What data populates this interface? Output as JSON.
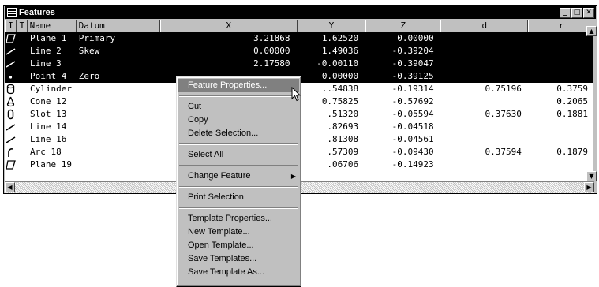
{
  "window": {
    "title": "Features",
    "buttons": [
      "_",
      "□",
      "✕"
    ]
  },
  "columns": [
    "I",
    "T",
    "Name",
    "Datum",
    "X",
    "Y",
    "Z",
    "d",
    "r"
  ],
  "rows": [
    {
      "icon": "plane-icon",
      "name": "Plane 1",
      "datum": "Primary",
      "x": "3.21868",
      "y": "1.62520",
      "z": "0.00000",
      "d": "",
      "r": "",
      "selected": true
    },
    {
      "icon": "line-icon",
      "name": "Line 2",
      "datum": "Skew",
      "x": "0.00000",
      "y": "1.49036",
      "z": "-0.39204",
      "d": "",
      "r": "",
      "selected": true
    },
    {
      "icon": "line-icon",
      "name": "Line 3",
      "datum": "",
      "x": "2.17580",
      "y": "-0.00110",
      "z": "-0.39047",
      "d": "",
      "r": "",
      "selected": true
    },
    {
      "icon": "point-icon",
      "name": "Point 4",
      "datum": "Zero",
      "x": "",
      "y": "0.00000",
      "z": "-0.39125",
      "d": "",
      "r": "",
      "selected": true
    },
    {
      "icon": "cylinder-icon",
      "name": "Cylinder",
      "datum": "",
      "x": "",
      "y": "..54838",
      "z": "-0.19314",
      "d": "0.75196",
      "r": "0.3759",
      "selected": false
    },
    {
      "icon": "cone-icon",
      "name": "Cone 12",
      "datum": "",
      "x": "",
      "y": "0.75825",
      "z": "-0.57692",
      "d": "",
      "r": "0.2065",
      "selected": false
    },
    {
      "icon": "slot-icon",
      "name": "Slot 13",
      "datum": "",
      "x": "",
      "y": ".51320",
      "z": "-0.05594",
      "d": "0.37630",
      "r": "0.1881",
      "selected": false
    },
    {
      "icon": "line-icon",
      "name": "Line 14",
      "datum": "",
      "x": "",
      "y": ".82693",
      "z": "-0.04518",
      "d": "",
      "r": "",
      "selected": false
    },
    {
      "icon": "line-icon",
      "name": "Line 16",
      "datum": "",
      "x": "",
      "y": ".81308",
      "z": "-0.04561",
      "d": "",
      "r": "",
      "selected": false
    },
    {
      "icon": "arc-icon",
      "name": "Arc 18",
      "datum": "",
      "x": "",
      "y": ".57309",
      "z": "-0.09430",
      "d": "0.37594",
      "r": "0.1879",
      "selected": false
    },
    {
      "icon": "plane-icon",
      "name": "Plane 19",
      "datum": "",
      "x": "",
      "y": ".06706",
      "z": "-0.14923",
      "d": "",
      "r": "",
      "selected": false
    }
  ],
  "menu": {
    "feature_properties": "Feature Properties...",
    "cut": "Cut",
    "copy": "Copy",
    "delete_selection": "Delete Selection...",
    "select_all": "Select All",
    "change_feature": "Change Feature",
    "print_selection": "Print Selection",
    "template_properties": "Template Properties...",
    "new_template": "New Template...",
    "open_template": "Open Template...",
    "save_templates": "Save Templates...",
    "save_template_as": "Save Template As..."
  }
}
